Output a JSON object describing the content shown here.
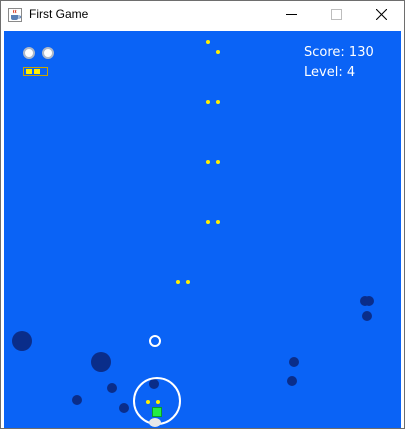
{
  "window": {
    "title": "First Game",
    "icon": "java-cup-icon",
    "controls": [
      "minimize",
      "maximize",
      "close"
    ]
  },
  "hud": {
    "score_text": "Score: 130",
    "level_text": "Level: 4",
    "lives": 2,
    "ammo_filled": 2,
    "ammo_total": 3
  },
  "colors": {
    "background": "#0a63f6",
    "enemy": "#0a2d8a",
    "bullet": "#ffee00",
    "player": "#22ee44",
    "ring": "#ffffff"
  }
}
